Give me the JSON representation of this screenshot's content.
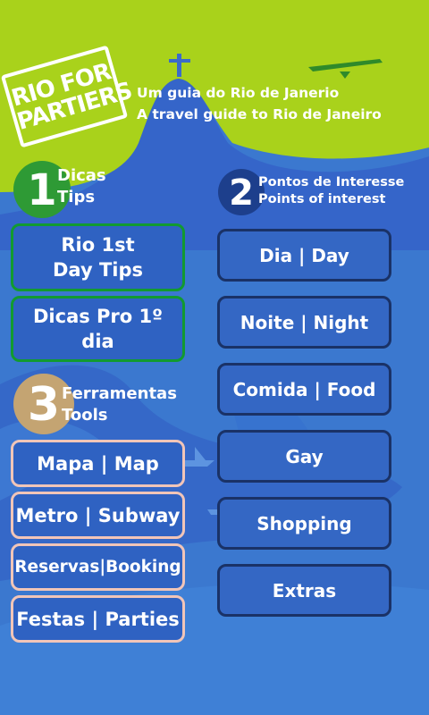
{
  "header": {
    "logo_text": "RIO FOR PARTIERS",
    "tagline_pt": "Um guia do Rio de Janerio",
    "tagline_en": "A travel guide to Rio de Janeiro"
  },
  "section_tips": {
    "number": "1",
    "title_pt": "Dicas",
    "title_en": "Tips"
  },
  "section_points": {
    "number": "2",
    "title_pt": "Pontos de Interesse",
    "title_en": "Points of interest"
  },
  "section_tools": {
    "number": "3",
    "title_pt": "Ferramentas",
    "title_en": "Tools"
  },
  "tips_buttons": [
    {
      "line1": "Rio 1st",
      "line2": "Day Tips"
    },
    {
      "line1": "Dicas Pro 1º",
      "line2": "dia"
    }
  ],
  "points_buttons": [
    "Dia | Day",
    "Noite | Night",
    "Comida | Food",
    "Gay",
    "Shopping",
    "Extras"
  ],
  "tools_buttons": [
    "Mapa | Map",
    "Metro | Subway",
    "Reservas|Booking",
    "Festas | Parties"
  ],
  "colors": {
    "lime": "#a9d21b",
    "blue": "#3b78cf",
    "green_border": "#129a30",
    "navy_border": "#1a3267",
    "pink_border": "#f1c5b8",
    "circle_1": "#2e9a35",
    "circle_2": "#1d3f8c",
    "circle_3": "#c4a472"
  },
  "icons": [
    "logo-stamp",
    "christ-statue-icon",
    "hang-glider-icon",
    "boat-icon"
  ]
}
